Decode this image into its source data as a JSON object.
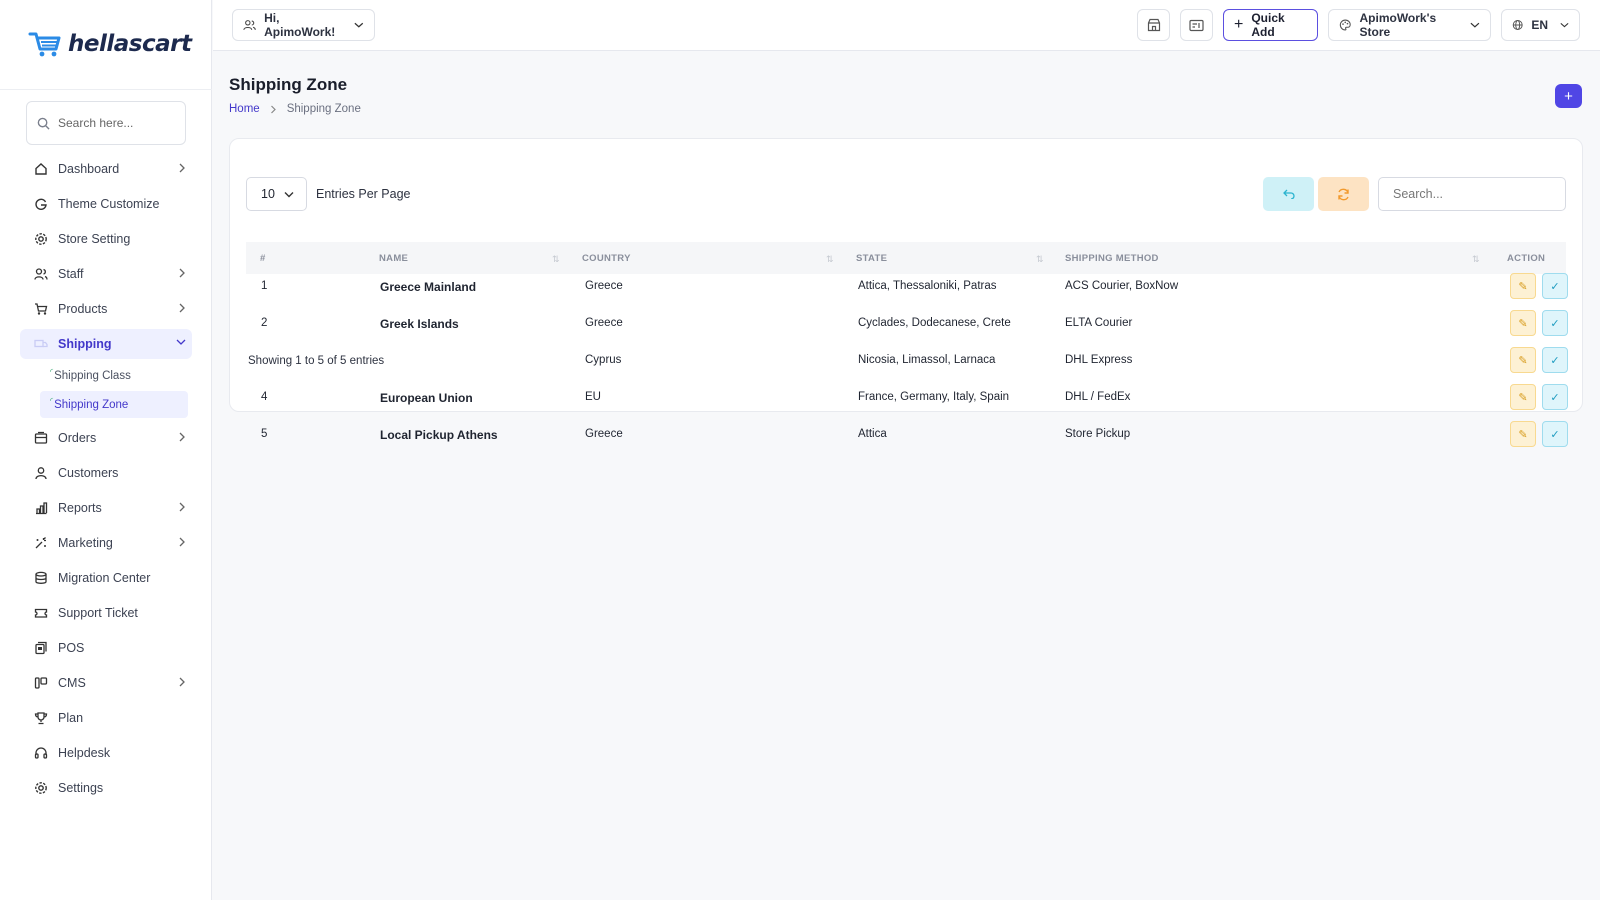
{
  "brand": {
    "name": "hellascart",
    "accent": "#5046e5",
    "logo_color": "#2b8be6"
  },
  "sidebar": {
    "search_placeholder": "Search here...",
    "items": [
      {
        "label": "Dashboard",
        "icon": "home-icon",
        "has_children": true
      },
      {
        "label": "Theme Customize",
        "icon": "theme-icon",
        "has_children": false
      },
      {
        "label": "Store Setting",
        "icon": "gear-icon",
        "has_children": false
      },
      {
        "label": "Staff",
        "icon": "users-icon",
        "has_children": true
      },
      {
        "label": "Products",
        "icon": "cart-icon",
        "has_children": true
      },
      {
        "label": "Shipping",
        "icon": "truck-icon",
        "has_children": true,
        "expanded": true
      },
      {
        "label": "Orders",
        "icon": "orders-icon",
        "has_children": true
      },
      {
        "label": "Customers",
        "icon": "user-icon",
        "has_children": false
      },
      {
        "label": "Reports",
        "icon": "chart-icon",
        "has_children": true
      },
      {
        "label": "Marketing",
        "icon": "marketing-icon",
        "has_children": true
      },
      {
        "label": "Migration Center",
        "icon": "database-icon",
        "has_children": false
      },
      {
        "label": "Support Ticket",
        "icon": "ticket-icon",
        "has_children": false
      },
      {
        "label": "POS",
        "icon": "pos-icon",
        "has_children": false
      },
      {
        "label": "CMS",
        "icon": "cms-icon",
        "has_children": true
      },
      {
        "label": "Plan",
        "icon": "trophy-icon",
        "has_children": false
      },
      {
        "label": "Helpdesk",
        "icon": "headset-icon",
        "has_children": false
      },
      {
        "label": "Settings",
        "icon": "settings-icon",
        "has_children": false
      }
    ],
    "shipping_sub": [
      {
        "label": "Shipping Class"
      },
      {
        "label": "Shipping Zone",
        "active": true
      }
    ]
  },
  "topbar": {
    "greeting": "Hi, ApimoWork!",
    "quick_add": "Quick Add",
    "store": "ApimoWork's Store",
    "language": "EN"
  },
  "page": {
    "title": "Shipping Zone",
    "breadcrumb": [
      "Home",
      "Shipping Zone"
    ]
  },
  "table": {
    "per_page": "10",
    "per_page_label": "Entries Per Page",
    "search_placeholder": "Search...",
    "columns": [
      "#",
      "Name",
      "Country",
      "State",
      "Shipping Method",
      "Action"
    ],
    "rows": [
      {
        "num": "1",
        "name": "Greece Mainland",
        "country": "Greece",
        "state": "Attica, Thessaloniki, Patras",
        "method": "ACS Courier, BoxNow"
      },
      {
        "num": "2",
        "name": "Greek Islands",
        "country": "Greece",
        "state": "Cyclades, Dodecanese, Crete",
        "method": "ELTA Courier"
      },
      {
        "num": "",
        "name": "",
        "country": "Cyprus",
        "state": "Nicosia, Limassol, Larnaca",
        "method": "DHL Express"
      },
      {
        "num": "4",
        "name": "European Union",
        "country": "EU",
        "state": "France, Germany, Italy, Spain",
        "method": "DHL / FedEx"
      },
      {
        "num": "5",
        "name": "Local Pickup Athens",
        "country": "Greece",
        "state": "Attica",
        "method": "Store Pickup"
      }
    ],
    "footer": "Showing 1 to 5 of 5 entries"
  }
}
